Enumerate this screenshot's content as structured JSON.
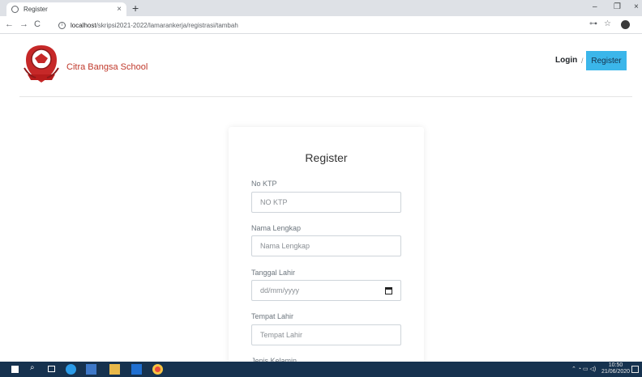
{
  "browser": {
    "tab_title": "Register",
    "tab_close": "×",
    "new_tab": "+",
    "minimize": "–",
    "restore": "❐",
    "close": "×",
    "back": "←",
    "forward": "→",
    "reload": "C",
    "url_host": "localhost",
    "url_path": "/skripsi2021-2022/lamarankerja/registrasi/tambah",
    "key_icon": "⊶",
    "star_icon": "☆"
  },
  "header": {
    "brand": "Citra Bangsa School",
    "login": "Login",
    "separator": "/",
    "register": "Register"
  },
  "form": {
    "title": "Register",
    "fields": [
      {
        "label": "No KTP",
        "placeholder": "NO KTP"
      },
      {
        "label": "Nama Lengkap",
        "placeholder": "Nama Lengkap"
      },
      {
        "label": "Tanggal Lahir",
        "placeholder": "dd/mm/yyyy"
      },
      {
        "label": "Tempat Lahir",
        "placeholder": "Tempat Lahir"
      },
      {
        "label": "Jenis Kelamin"
      }
    ]
  },
  "taskbar": {
    "time": "10:50",
    "date": "21/06/2020"
  },
  "colors": {
    "brand": "#c0392b",
    "register_button": "#3bb6ea",
    "taskbar": "#16324f"
  }
}
